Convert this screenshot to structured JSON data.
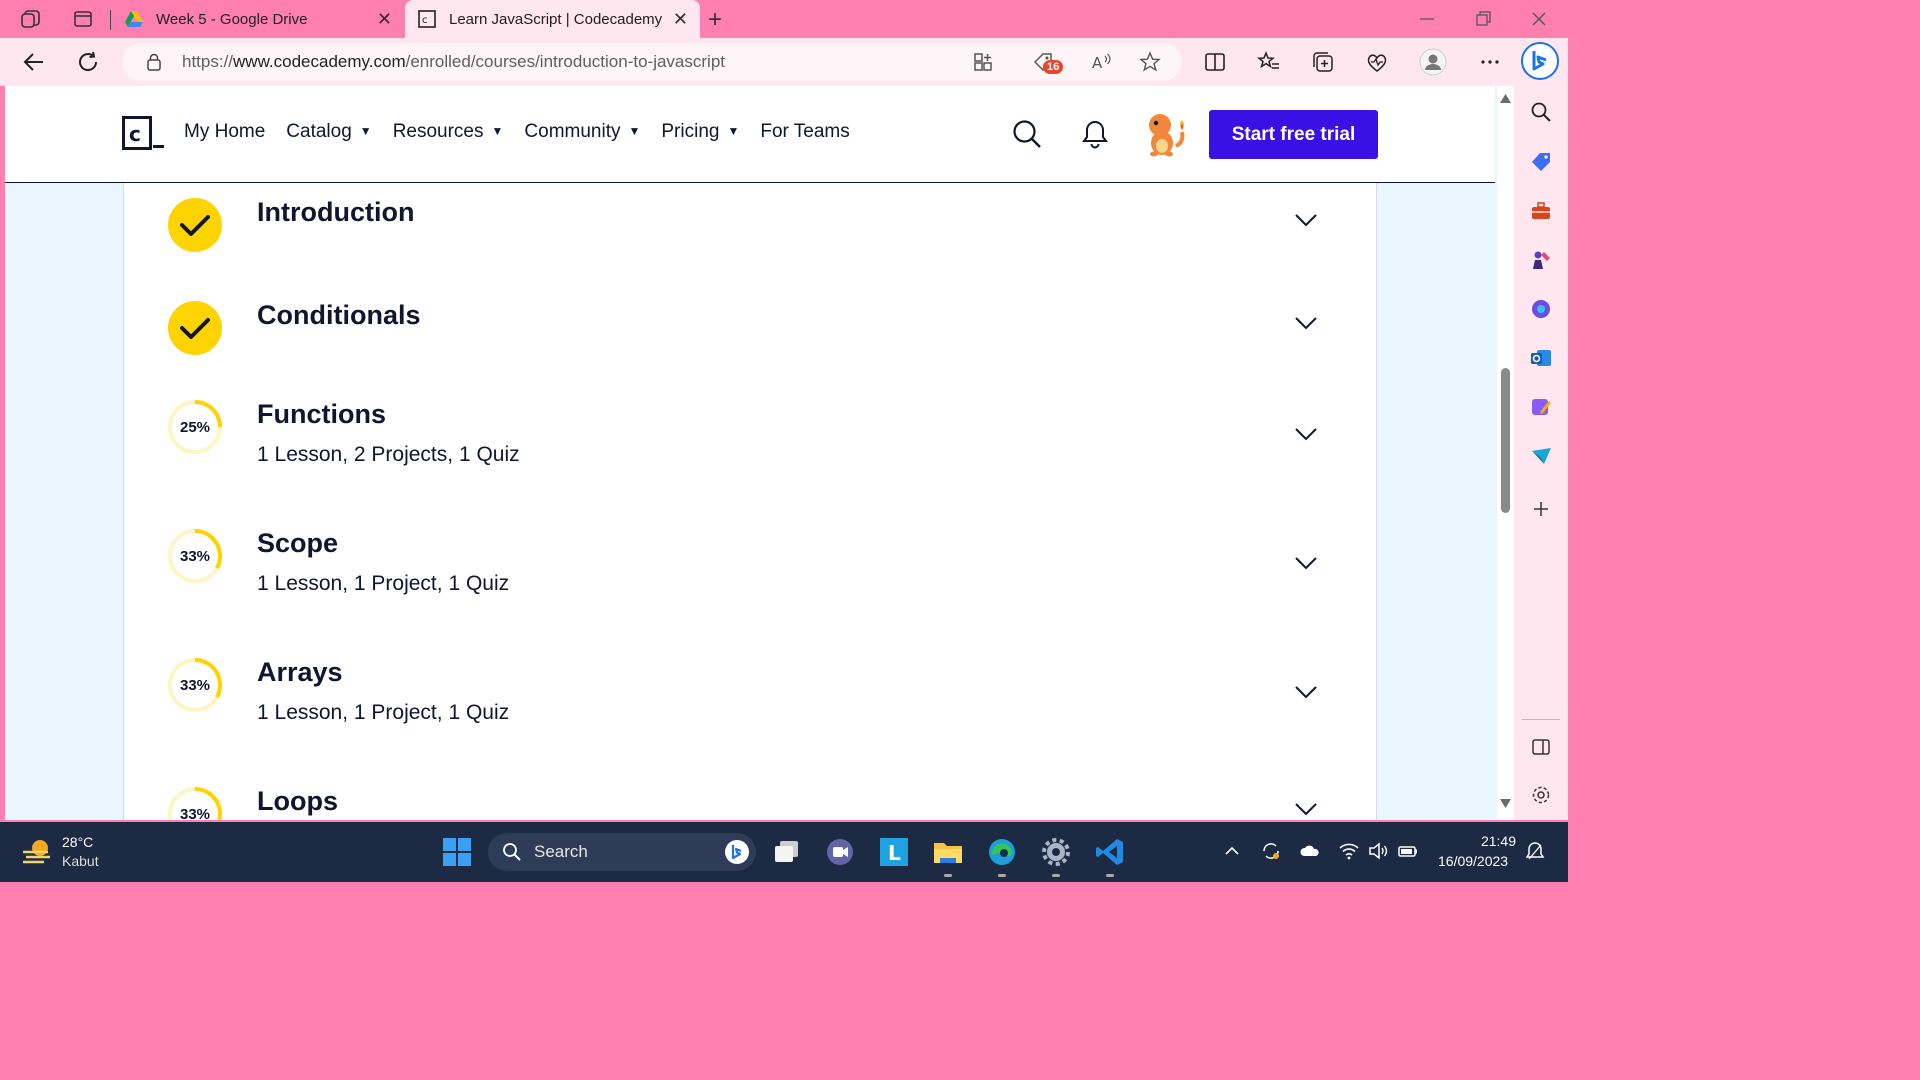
{
  "browser": {
    "tabs": [
      {
        "label": "Week 5 - Google Drive",
        "active": false
      },
      {
        "label": "Learn JavaScript | Codecademy",
        "active": true
      }
    ],
    "close_glyph": "✕",
    "new_tab_glyph": "+",
    "url_prefix": "https://",
    "url_domain": "www.codecademy.com",
    "url_path": "/enrolled/courses/introduction-to-javascript",
    "badge_count": "16"
  },
  "site": {
    "logo_icon": "codecademy-logo-icon",
    "nav": [
      {
        "label": "My Home",
        "caret": false
      },
      {
        "label": "Catalog",
        "caret": true
      },
      {
        "label": "Resources",
        "caret": true
      },
      {
        "label": "Community",
        "caret": true
      },
      {
        "label": "Pricing",
        "caret": true
      },
      {
        "label": "For Teams",
        "caret": false
      }
    ],
    "trial_button": "Start free trial",
    "accent_color": "#3a10e5",
    "progress_color": "#ffd300"
  },
  "modules": [
    {
      "title": "Introduction",
      "status": "complete",
      "progress": 1.0,
      "subtitle": ""
    },
    {
      "title": "Conditionals",
      "status": "complete",
      "progress": 1.0,
      "subtitle": ""
    },
    {
      "title": "Functions",
      "status": "in-progress",
      "progress": 0.25,
      "progress_label": "25%",
      "subtitle": "1 Lesson, 2 Projects, 1 Quiz"
    },
    {
      "title": "Scope",
      "status": "in-progress",
      "progress": 0.33,
      "progress_label": "33%",
      "subtitle": "1 Lesson, 1 Project, 1 Quiz"
    },
    {
      "title": "Arrays",
      "status": "in-progress",
      "progress": 0.33,
      "progress_label": "33%",
      "subtitle": "1 Lesson, 1 Project, 1 Quiz"
    },
    {
      "title": "Loops",
      "status": "in-progress",
      "progress": 0.33,
      "progress_label": "33%",
      "subtitle": ""
    }
  ],
  "taskbar": {
    "weather_temp": "28°C",
    "weather_condition": "Kabut",
    "search_placeholder": "Search",
    "time": "21:49",
    "date": "16/09/2023"
  }
}
